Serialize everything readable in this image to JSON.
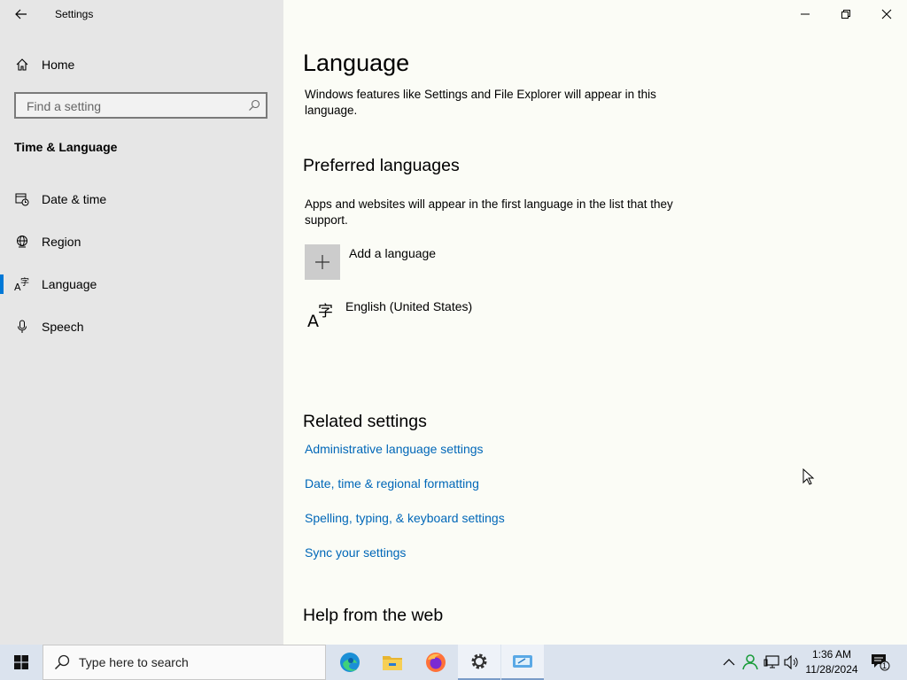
{
  "window": {
    "title": "Settings"
  },
  "sidebar": {
    "home_label": "Home",
    "search_placeholder": "Find a setting",
    "section_title": "Time & Language",
    "items": [
      {
        "label": "Date & time",
        "icon": "calendar-clock-icon"
      },
      {
        "label": "Region",
        "icon": "globe-icon"
      },
      {
        "label": "Language",
        "icon": "language-icon",
        "selected": true
      },
      {
        "label": "Speech",
        "icon": "microphone-icon"
      }
    ]
  },
  "main": {
    "title": "Language",
    "windows_display_desc": "Windows features like Settings and File Explorer will appear in this language.",
    "preferred_heading": "Preferred languages",
    "preferred_desc": "Apps and websites will appear in the first language in the list that they support.",
    "add_language_label": "Add a language",
    "languages": [
      {
        "name": "English (United States)"
      }
    ],
    "related_heading": "Related settings",
    "related_links": [
      "Administrative language settings",
      "Date, time & regional formatting",
      "Spelling, typing, & keyboard settings",
      "Sync your settings"
    ],
    "help_heading": "Help from the web"
  },
  "taskbar": {
    "search_placeholder": "Type here to search",
    "apps": [
      "edge-icon",
      "file-explorer-icon",
      "firefox-icon",
      "settings-icon",
      "app-window-icon"
    ],
    "clock_time": "1:36 AM",
    "clock_date": "11/28/2024",
    "notification_count": "1"
  },
  "colors": {
    "accent": "#0078d7",
    "link": "#0067b8",
    "sidebar_bg": "#e6e6e6",
    "content_bg": "#fbfcf6",
    "taskbar_bg": "#dbe3ee"
  }
}
